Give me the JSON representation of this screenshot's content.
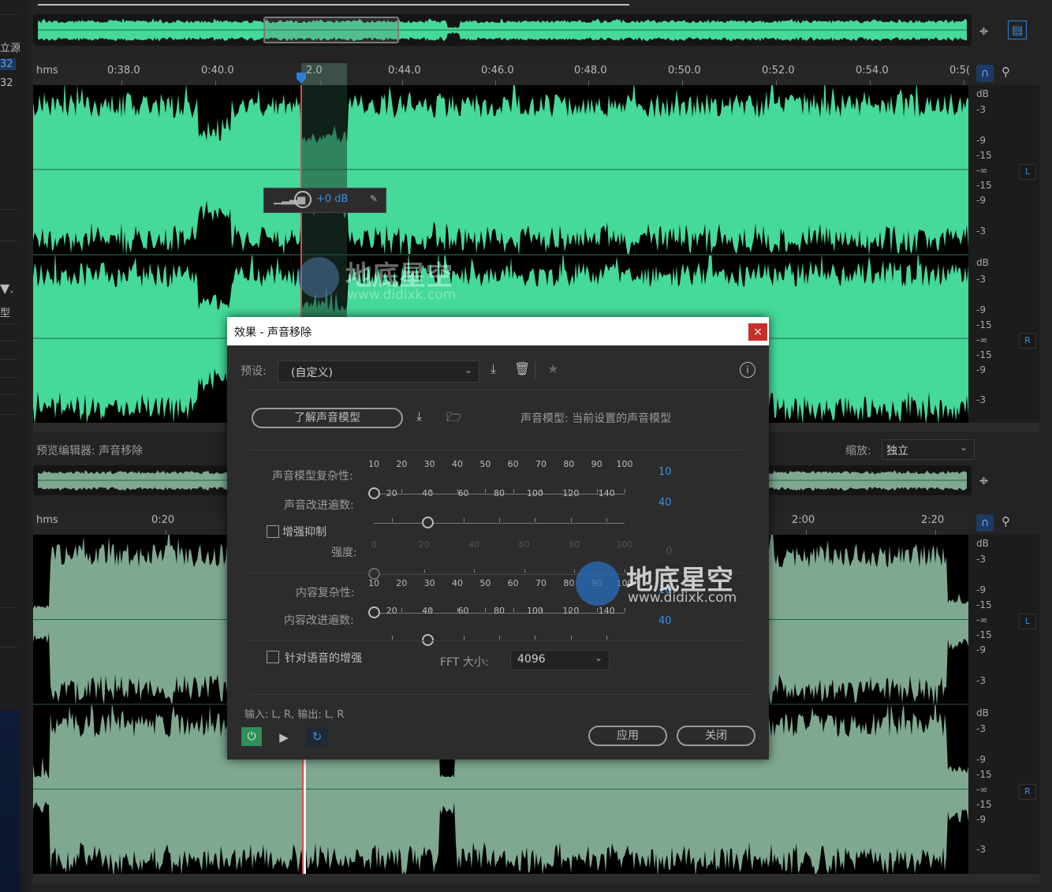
{
  "left_panel": {
    "items": [
      "立源",
      "32",
      "32",
      "型"
    ]
  },
  "top_editor": {
    "ruler_unit": "hms",
    "ruler_ticks": [
      "0:38.0",
      "0:40.0",
      "2.0",
      "0:44.0",
      "0:46.0",
      "0:48.0",
      "0:50.0",
      "0:52.0",
      "0:54.0",
      "0:5("
    ],
    "hud": {
      "gain": "+0 dB"
    },
    "db_labels": [
      "dB",
      "-3",
      "-9",
      "-15",
      "-∞",
      "-15",
      "-9",
      "-3"
    ],
    "channels": [
      "L",
      "R"
    ]
  },
  "preview": {
    "label": "预览编辑器: 声音移除",
    "zoom_label": "缩放:",
    "zoom_value": "独立",
    "ruler_unit": "hms",
    "ruler_ticks": [
      "0:20",
      "2:00",
      "2:20"
    ],
    "db_labels": [
      "dB",
      "-3",
      "-9",
      "-15",
      "-∞",
      "-15",
      "-9",
      "-3"
    ],
    "channels": [
      "L",
      "R"
    ]
  },
  "watermark": {
    "text": "地底星空",
    "url": "www.didixk.com"
  },
  "dialog": {
    "title": "效果 - 声音移除",
    "close_glyph": "×",
    "preset_label": "预设:",
    "preset_value": "(自定义)",
    "learn_button": "了解声音模型",
    "sound_model_status": "声音模型:  当前设置的声音模型",
    "sliders": [
      {
        "label": "声音模型复杂性:",
        "ticks": [
          "10",
          "20",
          "30",
          "40",
          "50",
          "60",
          "70",
          "80",
          "90",
          "100"
        ],
        "value": "10",
        "min": 10,
        "max": 100,
        "level": 10
      },
      {
        "label": "声音改进遍数:",
        "ticks": [
          "20",
          "40",
          "60",
          "80",
          "100",
          "120",
          "140"
        ],
        "value": "40",
        "min": 10,
        "max": 150,
        "level": 40
      },
      {
        "label": "强度:",
        "ticks": [
          "0",
          "20",
          "40",
          "60",
          "80",
          "100"
        ],
        "value": "0",
        "min": 0,
        "max": 100,
        "level": 0
      },
      {
        "label": "内容复杂性:",
        "ticks": [
          "10",
          "20",
          "30",
          "40",
          "50",
          "60",
          "70",
          "80",
          "90",
          "100"
        ],
        "value": "10",
        "min": 10,
        "max": 100,
        "level": 10
      },
      {
        "label": "内容改进遍数:",
        "ticks": [
          "20",
          "40",
          "60",
          "80",
          "100",
          "120",
          "140"
        ],
        "value": "40",
        "min": 10,
        "max": 150,
        "level": 40
      }
    ],
    "enhance_suppression": "增强抑制",
    "speech_enhance": "针对语音的增强",
    "fft_label": "FFT 大小:",
    "fft_value": "4096",
    "io_text": "输入: L, R,   输出: L, R",
    "apply_button": "应用",
    "close_button": "关闭"
  },
  "colors": {
    "waveform": "#45d99a",
    "preview_waveform": "#7fa891",
    "accent": "#3d8ee0",
    "close": "#c6302a",
    "power": "#2f8f5a"
  }
}
